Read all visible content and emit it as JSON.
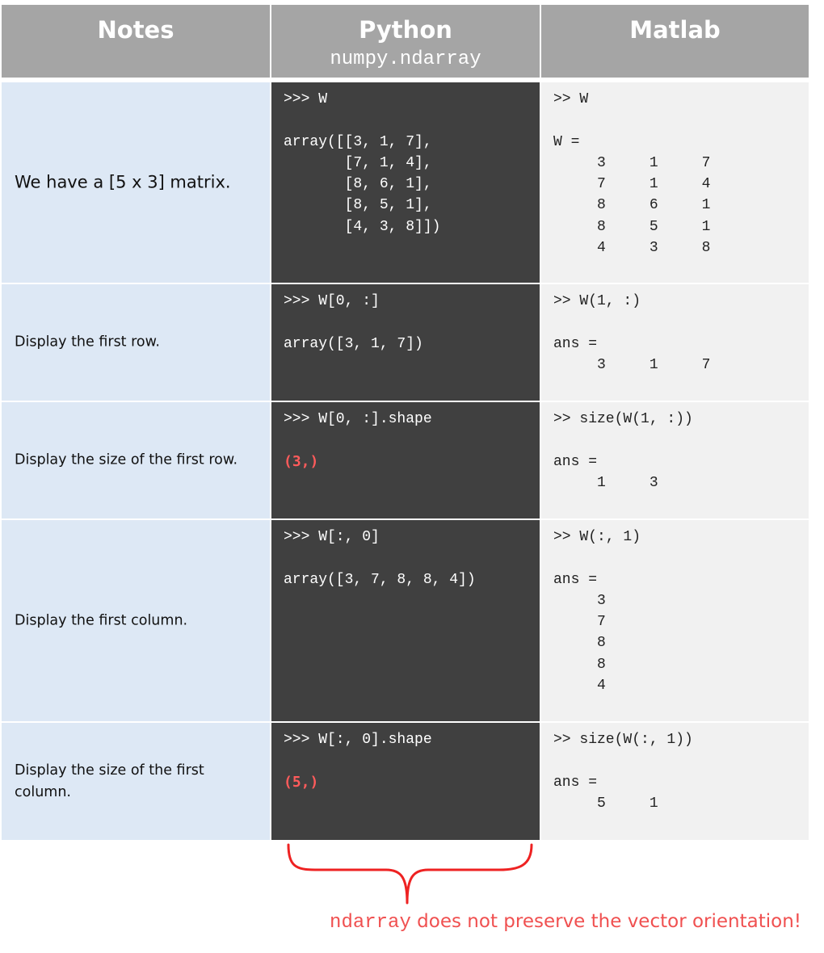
{
  "header": {
    "notes": "Notes",
    "python": "Python",
    "python_sub": "numpy.ndarray",
    "matlab": "Matlab"
  },
  "rows": [
    {
      "note": "We have a [5 x 3] matrix.",
      "py_cmd": ">>> W",
      "py_out": "array([[3, 1, 7],\n       [7, 1, 4],\n       [8, 6, 1],\n       [8, 5, 1],\n       [4, 3, 8]])",
      "ml": ">> W\n\nW =\n     3     1     7\n     7     1     4\n     8     6     1\n     8     5     1\n     4     3     8"
    },
    {
      "note": "Display the first row.",
      "py_cmd": ">>> W[0, :]",
      "py_out": "array([3, 1, 7])",
      "ml": ">> W(1, :)\n\nans =\n     3     1     7"
    },
    {
      "note": "Display the size of the first row.",
      "py_cmd": ">>> W[0, :].shape",
      "py_out": "(3,)",
      "ml": ">> size(W(1, :))\n\nans =\n     1     3"
    },
    {
      "note": "Display the first column.",
      "py_cmd": ">>> W[:, 0]",
      "py_out": "array([3, 7, 8, 8, 4])",
      "ml": ">> W(:, 1)\n\nans =\n     3\n     7\n     8\n     8\n     4"
    },
    {
      "note": "Display the size of the first column.",
      "py_cmd": ">>> W[:, 0].shape",
      "py_out": "(5,)",
      "ml": ">> size(W(:, 1))\n\nans =\n     5     1"
    }
  ],
  "footnote": {
    "code": "ndarray",
    "text": " does not preserve the vector orientation!"
  },
  "colors": {
    "header_bg": "#a5a5a5",
    "notes_bg": "#dde8f5",
    "python_bg": "#404040",
    "matlab_bg": "#f1f1f1",
    "accent_red": "#f05050"
  }
}
